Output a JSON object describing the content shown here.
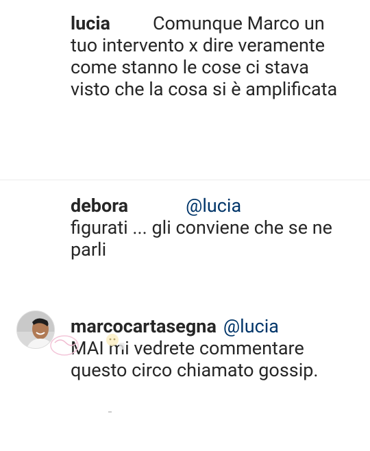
{
  "comments": [
    {
      "username": "lucia",
      "mention": "",
      "text": "Comunque Marco un tuo intervento x dire veramente come stanno le cose ci stava visto che la cosa si è amplificata"
    },
    {
      "username": "debora",
      "mention": "@lucia",
      "text": "figurati ... gli conviene che se ne parli"
    },
    {
      "username": "marcocartasegna",
      "mention": "@lucia",
      "text": "MAI mi vedrete commentare questo circo chiamato gossip."
    }
  ],
  "avatar": {
    "icon": "profile-photo"
  },
  "watermark": {
    "icon": "watermark-logo"
  },
  "colors": {
    "text": "#262626",
    "mention": "#003569",
    "divider": "#ececec"
  }
}
